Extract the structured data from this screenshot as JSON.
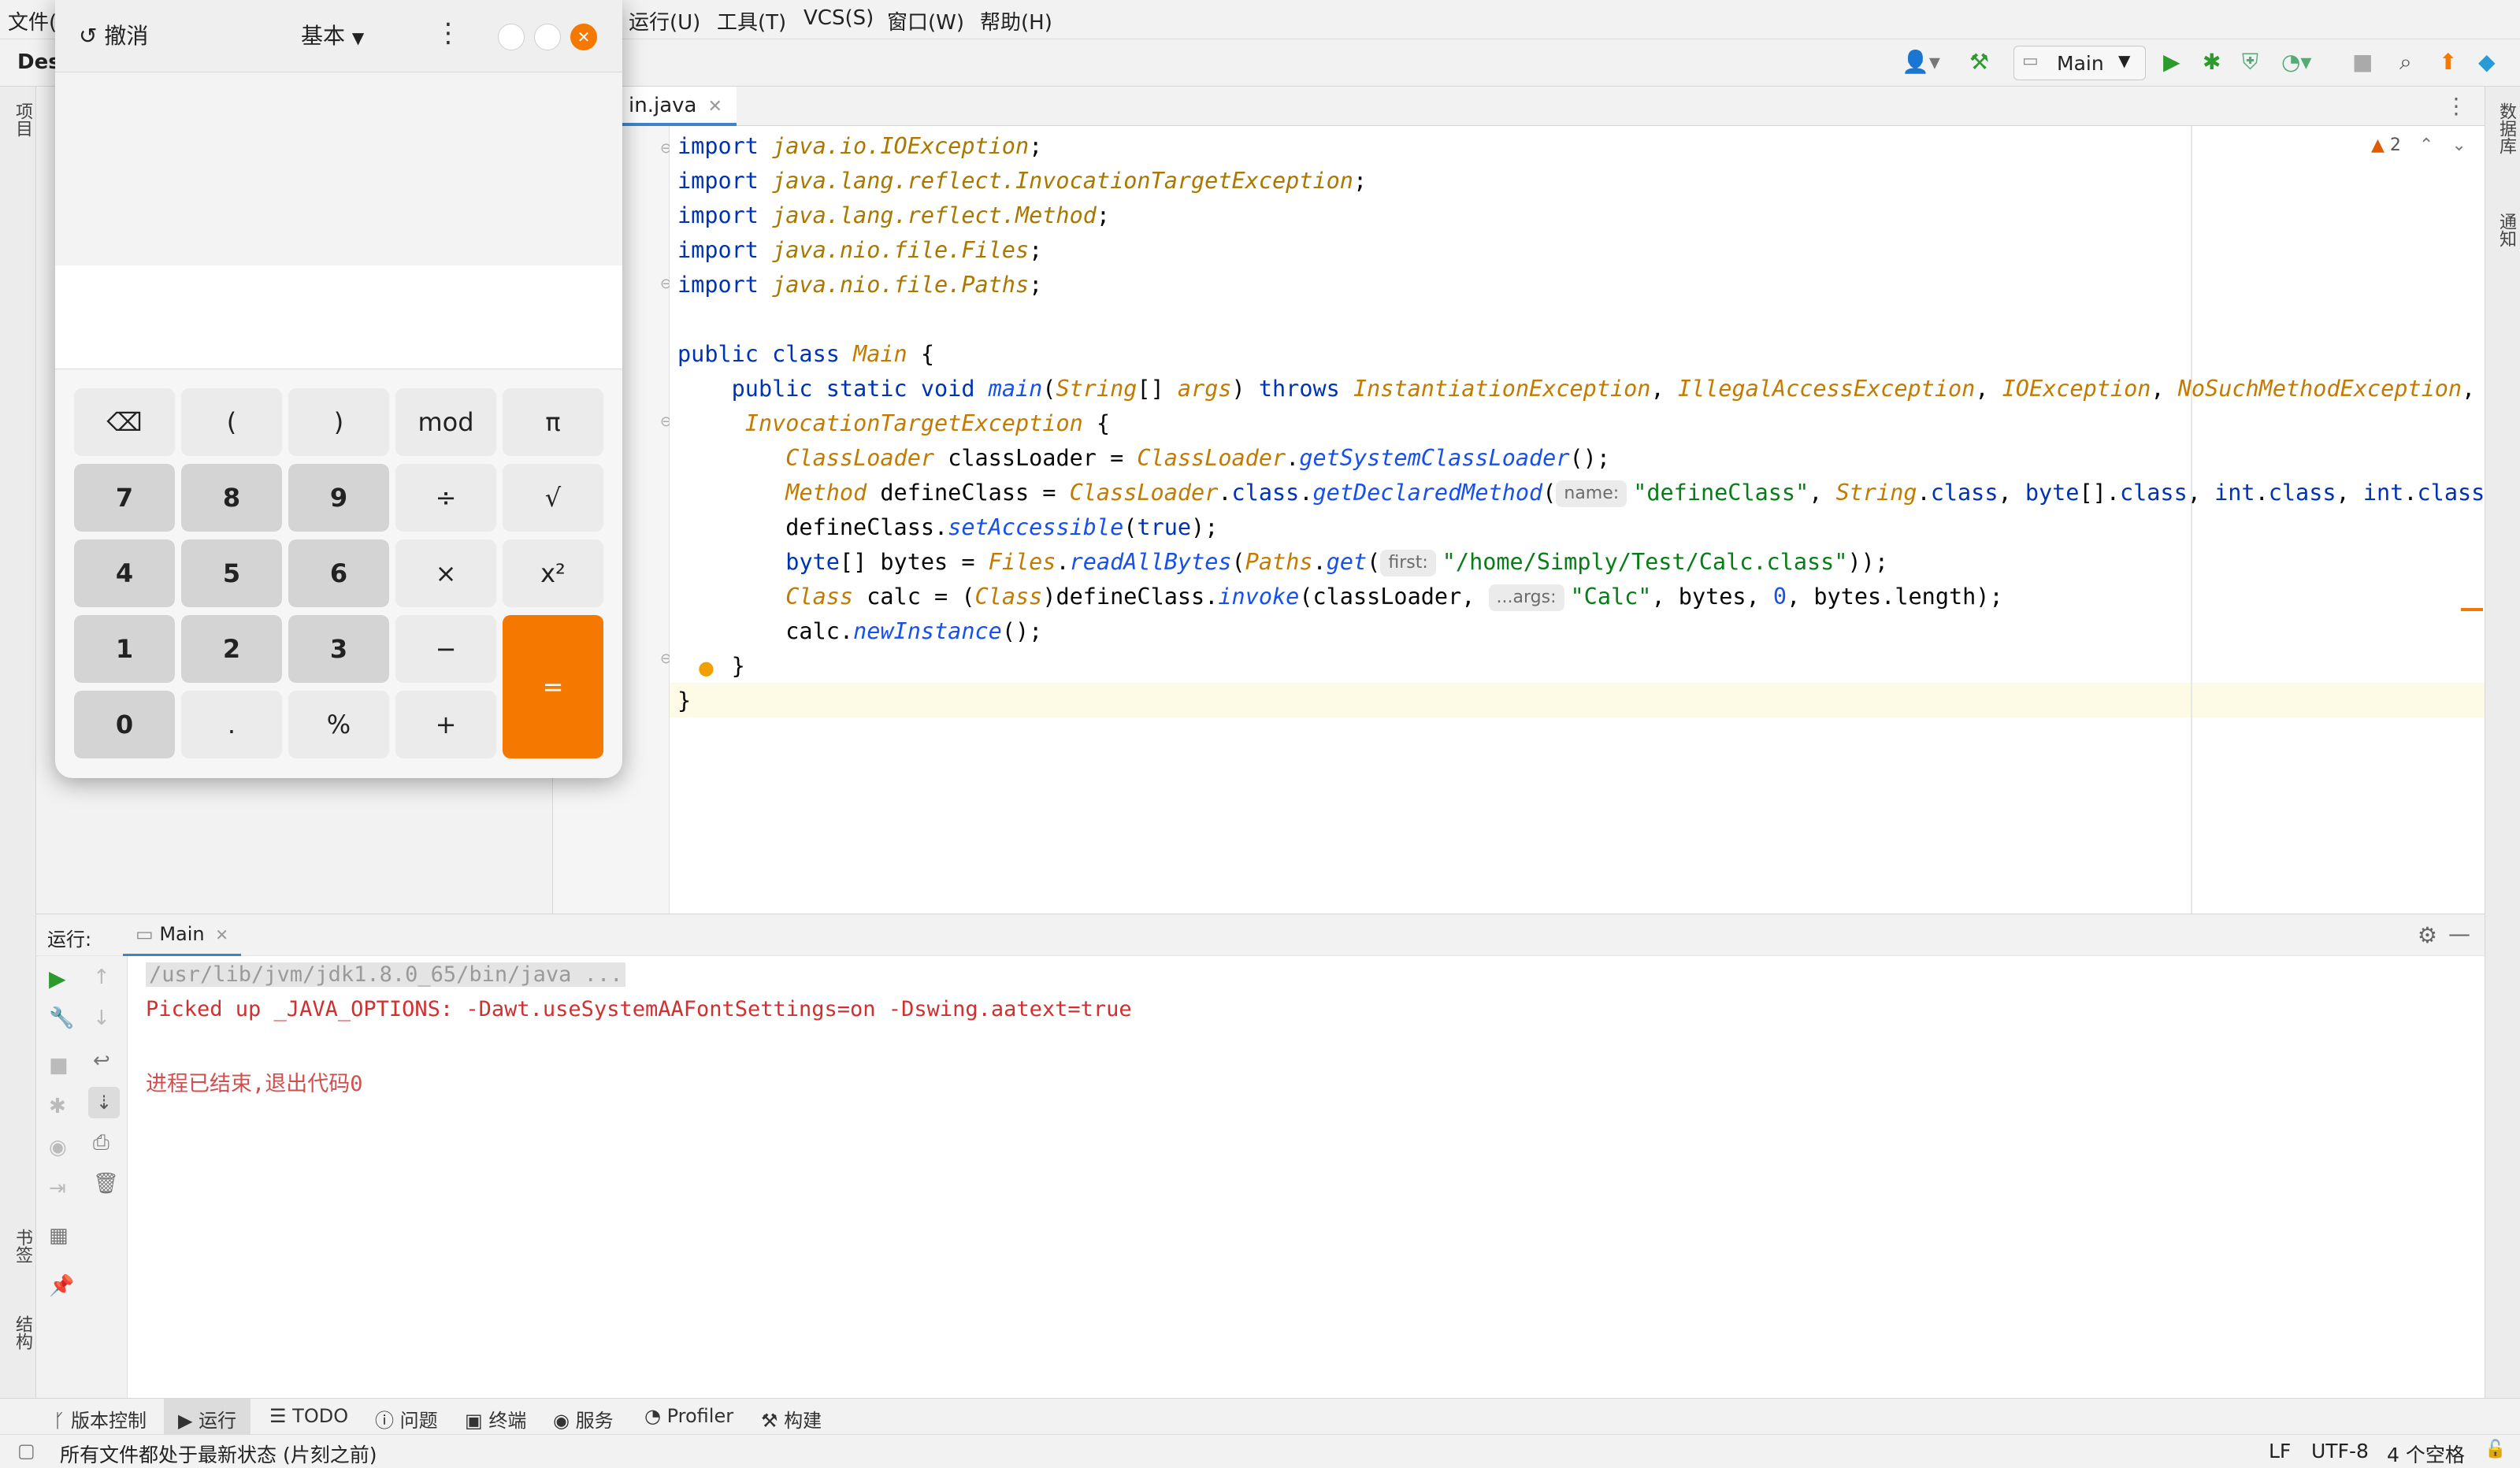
{
  "menubar": {
    "items": [
      "文件(",
      "运行(U)",
      "工具(T)",
      "VCS(S)",
      "窗口(W)",
      "帮助(H)"
    ]
  },
  "toolbar": {
    "project_label": "Des",
    "run_config": "Main"
  },
  "left_strip": {
    "project": "项目",
    "bookmarks": "书签",
    "structure": "结构"
  },
  "right_strip": {
    "database": "数据库",
    "notifications": "通知"
  },
  "editor": {
    "tab_name": "in.java",
    "warning_count": "2",
    "lines": [
      [
        {
          "c": "kw",
          "t": "import "
        },
        {
          "c": "pkg",
          "t": "java.io.IOException"
        },
        {
          "c": "plain",
          "t": ";"
        }
      ],
      [
        {
          "c": "kw",
          "t": "import "
        },
        {
          "c": "pkg",
          "t": "java.lang.reflect.InvocationTargetException"
        },
        {
          "c": "plain",
          "t": ";"
        }
      ],
      [
        {
          "c": "kw",
          "t": "import "
        },
        {
          "c": "pkg",
          "t": "java.lang.reflect.Method"
        },
        {
          "c": "plain",
          "t": ";"
        }
      ],
      [
        {
          "c": "kw",
          "t": "import "
        },
        {
          "c": "pkg",
          "t": "java.nio.file.Files"
        },
        {
          "c": "plain",
          "t": ";"
        }
      ],
      [
        {
          "c": "kw",
          "t": "import "
        },
        {
          "c": "pkg",
          "t": "java.nio.file.Paths"
        },
        {
          "c": "plain",
          "t": ";"
        }
      ],
      [],
      [
        {
          "c": "kw",
          "t": "public class "
        },
        {
          "c": "cls",
          "t": "Main "
        },
        {
          "c": "plain",
          "t": "{"
        }
      ],
      [
        {
          "c": "plain",
          "t": "    "
        },
        {
          "c": "kw",
          "t": "public static void "
        },
        {
          "c": "fn",
          "t": "main"
        },
        {
          "c": "plain",
          "t": "("
        },
        {
          "c": "cls",
          "t": "String"
        },
        {
          "c": "plain",
          "t": "[] "
        },
        {
          "c": "cls",
          "t": "args"
        },
        {
          "c": "plain",
          "t": ") "
        },
        {
          "c": "kw",
          "t": "throws "
        },
        {
          "c": "cls",
          "t": "InstantiationException"
        },
        {
          "c": "plain",
          "t": ", "
        },
        {
          "c": "cls",
          "t": "IllegalAccessException"
        },
        {
          "c": "plain",
          "t": ", "
        },
        {
          "c": "cls",
          "t": "IOException"
        },
        {
          "c": "plain",
          "t": ", "
        },
        {
          "c": "cls",
          "t": "NoSuchMethodException"
        },
        {
          "c": "plain",
          "t": ","
        }
      ],
      [
        {
          "c": "plain",
          "t": "     "
        },
        {
          "c": "cls",
          "t": "InvocationTargetException "
        },
        {
          "c": "plain",
          "t": "{"
        }
      ],
      [
        {
          "c": "plain",
          "t": "        "
        },
        {
          "c": "cls",
          "t": "ClassLoader "
        },
        {
          "c": "plain",
          "t": "classLoader = "
        },
        {
          "c": "cls",
          "t": "ClassLoader"
        },
        {
          "c": "plain",
          "t": "."
        },
        {
          "c": "fn",
          "t": "getSystemClassLoader"
        },
        {
          "c": "plain",
          "t": "();"
        }
      ],
      [
        {
          "c": "plain",
          "t": "        "
        },
        {
          "c": "cls",
          "t": "Method "
        },
        {
          "c": "plain",
          "t": "defineClass = "
        },
        {
          "c": "cls",
          "t": "ClassLoader"
        },
        {
          "c": "plain",
          "t": "."
        },
        {
          "c": "kw",
          "t": "class"
        },
        {
          "c": "plain",
          "t": "."
        },
        {
          "c": "fn",
          "t": "getDeclaredMethod"
        },
        {
          "c": "plain",
          "t": "("
        },
        {
          "c": "hint",
          "t": "name:"
        },
        {
          "c": "str",
          "t": "\"defineClass\""
        },
        {
          "c": "plain",
          "t": ", "
        },
        {
          "c": "cls",
          "t": "String"
        },
        {
          "c": "plain",
          "t": "."
        },
        {
          "c": "kw",
          "t": "class"
        },
        {
          "c": "plain",
          "t": ", "
        },
        {
          "c": "kw",
          "t": "byte"
        },
        {
          "c": "plain",
          "t": "[]."
        },
        {
          "c": "kw",
          "t": "class"
        },
        {
          "c": "plain",
          "t": ", "
        },
        {
          "c": "kw",
          "t": "int"
        },
        {
          "c": "plain",
          "t": "."
        },
        {
          "c": "kw",
          "t": "class"
        },
        {
          "c": "plain",
          "t": ", "
        },
        {
          "c": "kw",
          "t": "int"
        },
        {
          "c": "plain",
          "t": "."
        },
        {
          "c": "kw",
          "t": "class"
        },
        {
          "c": "plain",
          "t": ");"
        }
      ],
      [
        {
          "c": "plain",
          "t": "        defineClass."
        },
        {
          "c": "fn",
          "t": "setAccessible"
        },
        {
          "c": "plain",
          "t": "("
        },
        {
          "c": "kw",
          "t": "true"
        },
        {
          "c": "plain",
          "t": ");"
        }
      ],
      [
        {
          "c": "plain",
          "t": "        "
        },
        {
          "c": "kw",
          "t": "byte"
        },
        {
          "c": "plain",
          "t": "[] bytes = "
        },
        {
          "c": "cls",
          "t": "Files"
        },
        {
          "c": "plain",
          "t": "."
        },
        {
          "c": "fn",
          "t": "readAllBytes"
        },
        {
          "c": "plain",
          "t": "("
        },
        {
          "c": "cls",
          "t": "Paths"
        },
        {
          "c": "plain",
          "t": "."
        },
        {
          "c": "fn",
          "t": "get"
        },
        {
          "c": "plain",
          "t": "("
        },
        {
          "c": "hint",
          "t": "first:"
        },
        {
          "c": "str",
          "t": "\"/home/Simply/Test/Calc.class\""
        },
        {
          "c": "plain",
          "t": "));"
        }
      ],
      [
        {
          "c": "plain",
          "t": "        "
        },
        {
          "c": "cls",
          "t": "Class "
        },
        {
          "c": "plain",
          "t": "calc = ("
        },
        {
          "c": "cls",
          "t": "Class"
        },
        {
          "c": "plain",
          "t": ")defineClass."
        },
        {
          "c": "fn",
          "t": "invoke"
        },
        {
          "c": "plain",
          "t": "(classLoader, "
        },
        {
          "c": "hint",
          "t": "...args:"
        },
        {
          "c": "str",
          "t": "\"Calc\""
        },
        {
          "c": "plain",
          "t": ", bytes, "
        },
        {
          "c": "num",
          "t": "0"
        },
        {
          "c": "plain",
          "t": ", bytes.length);"
        }
      ],
      [
        {
          "c": "plain",
          "t": "        calc."
        },
        {
          "c": "fn",
          "t": "newInstance"
        },
        {
          "c": "plain",
          "t": "();"
        }
      ],
      [
        {
          "c": "plain",
          "t": "    }"
        }
      ],
      [
        {
          "c": "plain",
          "t": "}"
        }
      ]
    ]
  },
  "run_panel": {
    "label": "运行:",
    "tab": "Main",
    "console_lines": [
      {
        "text": "/usr/lib/jvm/jdk1.8.0_65/bin/java ...",
        "color": "#9a9a9a"
      },
      {
        "text": "Picked up _JAVA_OPTIONS: -Dawt.useSystemAAFontSettings=on -Dswing.aatext=true",
        "color": "#d03030"
      },
      {
        "text": "",
        "color": "#222222"
      },
      {
        "text": "进程已结束,退出代码0",
        "color": "#d05050"
      }
    ]
  },
  "bottom_tools": [
    "版本控制",
    "运行",
    "TODO",
    "问题",
    "终端",
    "服务",
    "Profiler",
    "构建"
  ],
  "status": {
    "message": "所有文件都处于最新状态 (片刻之前)",
    "line_sep": "LF",
    "encoding": "UTF-8",
    "indent": "4 个空格"
  },
  "calculator": {
    "undo": "撤消",
    "mode": "基本",
    "keys": [
      {
        "label": "⌫",
        "kind": "op"
      },
      {
        "label": "(",
        "kind": "op"
      },
      {
        "label": ")",
        "kind": "op"
      },
      {
        "label": "mod",
        "kind": "op"
      },
      {
        "label": "π",
        "kind": "op"
      },
      {
        "label": "7",
        "kind": "num"
      },
      {
        "label": "8",
        "kind": "num"
      },
      {
        "label": "9",
        "kind": "num"
      },
      {
        "label": "÷",
        "kind": "op"
      },
      {
        "label": "√",
        "kind": "op"
      },
      {
        "label": "4",
        "kind": "num"
      },
      {
        "label": "5",
        "kind": "num"
      },
      {
        "label": "6",
        "kind": "num"
      },
      {
        "label": "×",
        "kind": "op"
      },
      {
        "label": "x²",
        "kind": "op"
      },
      {
        "label": "1",
        "kind": "num"
      },
      {
        "label": "2",
        "kind": "num"
      },
      {
        "label": "3",
        "kind": "num"
      },
      {
        "label": "−",
        "kind": "op"
      },
      {
        "label": "0",
        "kind": "num"
      },
      {
        "label": ".",
        "kind": "op"
      },
      {
        "label": "%",
        "kind": "op"
      },
      {
        "label": "+",
        "kind": "op"
      }
    ],
    "equals": "="
  },
  "colors": {
    "accent": "#f57900",
    "run_green": "#2d9a2d",
    "tab_underline": "#4083c9"
  }
}
